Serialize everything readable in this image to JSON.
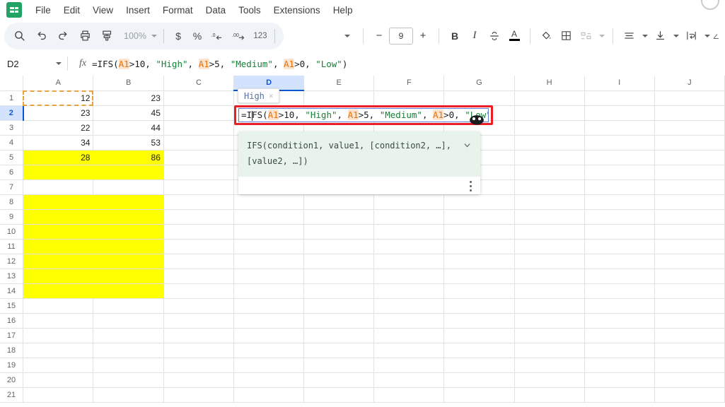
{
  "app": {
    "name": "Google Sheets",
    "logo_icon": "sheets-logo-icon"
  },
  "menubar": {
    "items": [
      {
        "label": "File",
        "name": "menu-file"
      },
      {
        "label": "Edit",
        "name": "menu-edit"
      },
      {
        "label": "View",
        "name": "menu-view"
      },
      {
        "label": "Insert",
        "name": "menu-insert"
      },
      {
        "label": "Format",
        "name": "menu-format"
      },
      {
        "label": "Data",
        "name": "menu-data"
      },
      {
        "label": "Tools",
        "name": "menu-tools"
      },
      {
        "label": "Extensions",
        "name": "menu-extensions"
      },
      {
        "label": "Help",
        "name": "menu-help"
      }
    ]
  },
  "toolbar": {
    "search_icon": "search-icon",
    "undo_icon": "undo-icon",
    "redo_icon": "redo-icon",
    "print_icon": "print-icon",
    "paint_format_icon": "paint-format-icon",
    "zoom_value": "100%",
    "currency_label": "$",
    "percent_label": "%",
    "decrease_decimal_label": ".0",
    "increase_decimal_label": ".00",
    "more_formats_label": "123",
    "font_size_value": "9",
    "minus_label": "−",
    "plus_label": "+",
    "bold_label": "B",
    "italic_label": "I",
    "strikethrough_icon": "strikethrough-icon",
    "text_color_label": "A",
    "fill_color_icon": "fill-color-icon",
    "borders_icon": "borders-icon",
    "merge_cells_icon": "merge-cells-icon",
    "horizontal_align_icon": "horizontal-align-icon",
    "vertical_align_icon": "vertical-align-icon",
    "text_wrap_icon": "text-wrap-icon",
    "overflow_icon": "toolbar-overflow-icon"
  },
  "formula_bar": {
    "name_box_value": "D2",
    "name_box_caret_icon": "chevron-down-icon",
    "fx_label": "fx",
    "formula_parts": [
      {
        "text": "=IFS(",
        "style": "plain"
      },
      {
        "text": "A1",
        "style": "ref"
      },
      {
        "text": ">10, ",
        "style": "plain"
      },
      {
        "text": "\"High\"",
        "style": "string"
      },
      {
        "text": ", ",
        "style": "plain"
      },
      {
        "text": "A1",
        "style": "ref"
      },
      {
        "text": ">5, ",
        "style": "plain"
      },
      {
        "text": "\"Medium\"",
        "style": "string"
      },
      {
        "text": ", ",
        "style": "plain"
      },
      {
        "text": "A1",
        "style": "ref"
      },
      {
        "text": ">0, ",
        "style": "plain"
      },
      {
        "text": "\"Low\"",
        "style": "string"
      },
      {
        "text": ")",
        "style": "plain"
      }
    ],
    "formula_plain": "=IFS(A1>10, \"High\", A1>5, \"Medium\", A1>0, \"Low\")"
  },
  "cell_editor": {
    "active_cell": "D2",
    "prefix": "=I",
    "suffix_parts": [
      {
        "text": "FS(",
        "style": "plain"
      },
      {
        "text": "A1",
        "style": "ref"
      },
      {
        "text": ">10, ",
        "style": "plain"
      },
      {
        "text": "\"High\"",
        "style": "string"
      },
      {
        "text": ", ",
        "style": "plain"
      },
      {
        "text": "A1",
        "style": "ref"
      },
      {
        "text": ">5, ",
        "style": "plain"
      },
      {
        "text": "\"Medium\"",
        "style": "string"
      },
      {
        "text": ", ",
        "style": "plain"
      },
      {
        "text": "A1",
        "style": "ref"
      },
      {
        "text": ">0, ",
        "style": "plain"
      },
      {
        "text": "\"Low\"",
        "style": "string"
      },
      {
        "text": ")",
        "style": "plain"
      }
    ],
    "highlight_color": "#ee1c25",
    "preview_chip": {
      "label": "High",
      "dismiss_label": "×"
    }
  },
  "function_tooltip": {
    "signature_line1": "IFS(condition1, value1, [condition2, …],",
    "signature_line2": "[value2, …])",
    "collapse_icon": "chevron-down-icon",
    "more_icon": "more-vertical-icon",
    "background": "#e8f3ec"
  },
  "grid": {
    "columns": [
      "A",
      "B",
      "C",
      "D",
      "E",
      "F",
      "G",
      "H",
      "I",
      "J"
    ],
    "selected_column": "D",
    "selected_row": 2,
    "reference_cell": "A1",
    "reference_border_color": "#e8a33d",
    "highlight_fill": "#ffff00",
    "rows": [
      {
        "n": "1",
        "cells": [
          "12",
          "23",
          "",
          "",
          "",
          "",
          "",
          "",
          "",
          ""
        ]
      },
      {
        "n": "2",
        "cells": [
          "23",
          "45",
          "",
          "",
          "",
          "",
          "",
          "",
          "",
          ""
        ]
      },
      {
        "n": "3",
        "cells": [
          "22",
          "44",
          "",
          "",
          "",
          "",
          "",
          "",
          "",
          ""
        ]
      },
      {
        "n": "4",
        "cells": [
          "34",
          "53",
          "",
          "",
          "",
          "",
          "",
          "",
          "",
          ""
        ]
      },
      {
        "n": "5",
        "cells": [
          "28",
          "86",
          "",
          "",
          "",
          "",
          "",
          "",
          "",
          ""
        ]
      },
      {
        "n": "6",
        "cells": [
          "",
          "",
          "",
          "",
          "",
          "",
          "",
          "",
          "",
          ""
        ]
      },
      {
        "n": "7",
        "cells": [
          "",
          "",
          "",
          "",
          "",
          "",
          "",
          "",
          "",
          ""
        ]
      },
      {
        "n": "8",
        "cells": [
          "",
          "",
          "",
          "",
          "",
          "",
          "",
          "",
          "",
          ""
        ]
      },
      {
        "n": "9",
        "cells": [
          "",
          "",
          "",
          "",
          "",
          "",
          "",
          "",
          "",
          ""
        ]
      },
      {
        "n": "10",
        "cells": [
          "",
          "",
          "",
          "",
          "",
          "",
          "",
          "",
          "",
          ""
        ]
      },
      {
        "n": "11",
        "cells": [
          "",
          "",
          "",
          "",
          "",
          "",
          "",
          "",
          "",
          ""
        ]
      },
      {
        "n": "12",
        "cells": [
          "",
          "",
          "",
          "",
          "",
          "",
          "",
          "",
          "",
          ""
        ]
      },
      {
        "n": "13",
        "cells": [
          "",
          "",
          "",
          "",
          "",
          "",
          "",
          "",
          "",
          ""
        ]
      },
      {
        "n": "14",
        "cells": [
          "",
          "",
          "",
          "",
          "",
          "",
          "",
          "",
          "",
          ""
        ]
      },
      {
        "n": "15",
        "cells": [
          "",
          "",
          "",
          "",
          "",
          "",
          "",
          "",
          "",
          ""
        ]
      },
      {
        "n": "16",
        "cells": [
          "",
          "",
          "",
          "",
          "",
          "",
          "",
          "",
          "",
          ""
        ]
      },
      {
        "n": "17",
        "cells": [
          "",
          "",
          "",
          "",
          "",
          "",
          "",
          "",
          "",
          ""
        ]
      },
      {
        "n": "18",
        "cells": [
          "",
          "",
          "",
          "",
          "",
          "",
          "",
          "",
          "",
          ""
        ]
      },
      {
        "n": "19",
        "cells": [
          "",
          "",
          "",
          "",
          "",
          "",
          "",
          "",
          "",
          ""
        ]
      },
      {
        "n": "20",
        "cells": [
          "",
          "",
          "",
          "",
          "",
          "",
          "",
          "",
          "",
          ""
        ]
      },
      {
        "n": "21",
        "cells": [
          "",
          "",
          "",
          "",
          "",
          "",
          "",
          "",
          "",
          ""
        ]
      }
    ],
    "yellow_ranges": [
      {
        "row_start": 5,
        "row_end": 6,
        "col_start": 0,
        "col_end": 1
      },
      {
        "row_start": 8,
        "row_end": 14,
        "col_start": 0,
        "col_end": 1
      }
    ]
  }
}
